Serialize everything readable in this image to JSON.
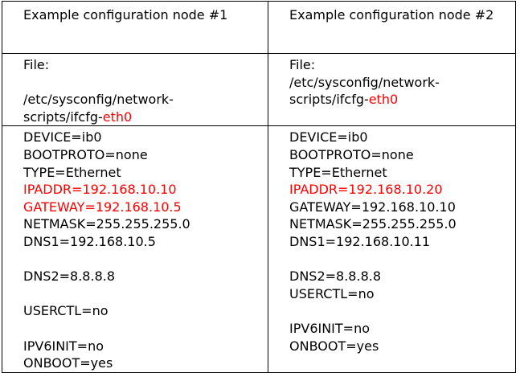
{
  "colors": {
    "highlight": "#ff0000",
    "text": "#000000",
    "border": "#000000"
  },
  "headers": {
    "node1": "Example configuration node #1",
    "node2": "Example configuration node #2"
  },
  "file": {
    "node1": {
      "label": "File:",
      "path_line1": "/etc/sysconfig/network-",
      "path_line2_prefix": "scripts/ifcfg-",
      "path_line2_iface": "eth0"
    },
    "node2": {
      "label": "File:",
      "path_line1": "/etc/sysconfig/network-",
      "path_line2_prefix": "scripts/ifcfg-",
      "path_line2_iface": "eth0"
    }
  },
  "config": {
    "node1": {
      "device": "DEVICE=ib0",
      "bootproto": "BOOTPROTO=none",
      "type": "TYPE=Ethernet",
      "ipaddr": "IPADDR=192.168.10.10",
      "gateway": "GATEWAY=192.168.10.5",
      "netmask": "NETMASK=255.255.255.0",
      "dns1": "DNS1=192.168.10.5",
      "dns2": "DNS2=8.8.8.8",
      "userctl": "USERCTL=no",
      "ipv6init": "IPV6INIT=no",
      "onboot": "ONBOOT=yes"
    },
    "node2": {
      "device": "DEVICE=ib0",
      "bootproto": "BOOTPROTO=none",
      "type": "TYPE=Ethernet",
      "ipaddr": "IPADDR=192.168.10.20",
      "gateway": "GATEWAY=192.168.10.10",
      "netmask": "NETMASK=255.255.255.0",
      "dns1": "DNS1=192.168.10.11",
      "dns2": "DNS2=8.8.8.8",
      "userctl": "USERCTL=no",
      "ipv6init": "IPV6INIT=no",
      "onboot": "ONBOOT=yes"
    }
  }
}
